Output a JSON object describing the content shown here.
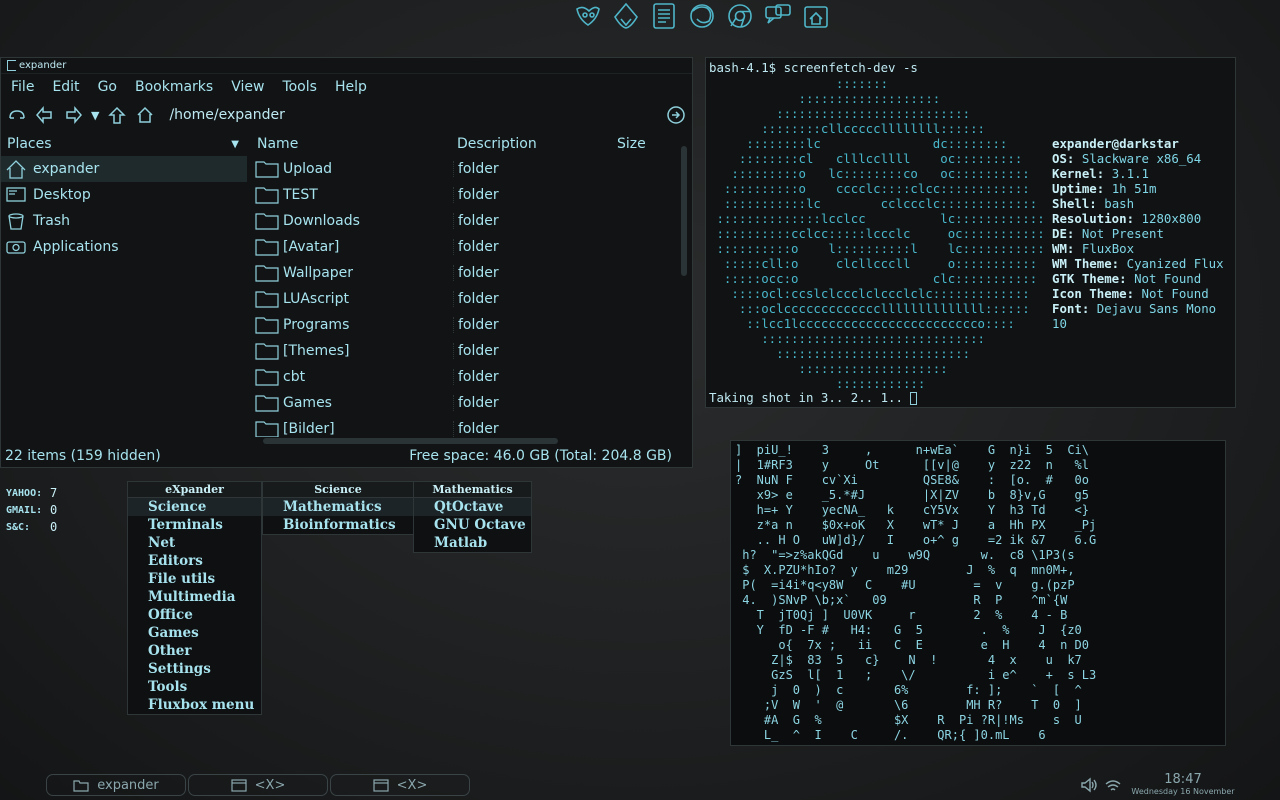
{
  "launcher": {
    "icons": [
      "gimp-icon",
      "inkscape-icon",
      "text-editor-icon",
      "firefox-icon",
      "chrome-icon",
      "chat-icon",
      "home-icon"
    ]
  },
  "filemanager": {
    "title": "expander",
    "menu": [
      "File",
      "Edit",
      "Go",
      "Bookmarks",
      "View",
      "Tools",
      "Help"
    ],
    "path": "/home/expander",
    "places_label": "Places",
    "places": [
      {
        "label": "expander",
        "icon": "home-icon",
        "selected": true
      },
      {
        "label": "Desktop",
        "icon": "desktop-icon",
        "selected": false
      },
      {
        "label": "Trash",
        "icon": "trash-icon",
        "selected": false
      },
      {
        "label": "Applications",
        "icon": "applications-icon",
        "selected": false
      }
    ],
    "columns": {
      "name": "Name",
      "desc": "Description",
      "size": "Size"
    },
    "files": [
      {
        "name": "Upload",
        "desc": "folder"
      },
      {
        "name": "TEST",
        "desc": "folder"
      },
      {
        "name": "Downloads",
        "desc": "folder"
      },
      {
        "name": "[Avatar]",
        "desc": "folder"
      },
      {
        "name": "Wallpaper",
        "desc": "folder"
      },
      {
        "name": "LUAscript",
        "desc": "folder"
      },
      {
        "name": "Programs",
        "desc": "folder"
      },
      {
        "name": "[Themes]",
        "desc": "folder"
      },
      {
        "name": "cbt",
        "desc": "folder"
      },
      {
        "name": "Games",
        "desc": "folder"
      },
      {
        "name": "[Bilder]",
        "desc": "folder"
      }
    ],
    "status_left": "22 items (159 hidden)",
    "status_right": "Free space: 46.0 GB (Total: 204.8 GB)"
  },
  "terminal": {
    "command": "bash-4.1$ screenfetch-dev -s",
    "ascii_art": "                 :::::::\n            :::::::::::::::::::\n         ::::::::::::::::::::::::::\n       ::::::::cllcccccllllllll::::::\n     ::::::::lc               dc::::::::\n    ::::::::cl   clllccllll    oc:::::::::\n   :::::::::o   lc::::::::co   oc::::::::::\n  ::::::::::o    cccclc::::clcc::::::::::::\n  :::::::::::lc        cclccclc:::::::::::::\n ::::::::::::::lcclcc          lc::::::::::::\n ::::::::::cclcc:::::lccclc     oc:::::::::::\n ::::::::::o    l::::::::::l    lc:::::::::::\n  :::::cll:o     clcllcccll     o:::::::::::\n  :::::occ:o                  clc:::::::::::\n   ::::ocl:ccslclccclclccclclc:::::::::::::\n    :::oclcccccccccccccllllllllllllll::::::\n     ::lcc1lcccccccccccccccccccccccco::::\n       ::::::::::::::::::::::::::::::\n         ::::::::::::::::::::::::::\n            ::::::::::::::::::::\n                 ::::::::::::",
    "user": "expander@darkstar",
    "info": [
      {
        "k": "OS:",
        "v": "Slackware x86_64"
      },
      {
        "k": "Kernel:",
        "v": "3.1.1"
      },
      {
        "k": "Uptime:",
        "v": "1h 51m"
      },
      {
        "k": "Shell:",
        "v": "bash"
      },
      {
        "k": "Resolution:",
        "v": "1280x800"
      },
      {
        "k": "DE:",
        "v": "Not Present"
      },
      {
        "k": "WM:",
        "v": "FluxBox"
      },
      {
        "k": "WM Theme:",
        "v": "Cyanized Flux"
      },
      {
        "k": "GTK Theme:",
        "v": "Not Found"
      },
      {
        "k": "Icon Theme:",
        "v": "Not Found"
      },
      {
        "k": "Font:",
        "v": "Dejavu Sans Mono 10"
      }
    ],
    "prompt": "Taking shot in 3.. 2.. 1.. "
  },
  "mail_status": [
    {
      "label": "YAHOO:",
      "count": "7"
    },
    {
      "label": "GMAIL:",
      "count": "0"
    },
    {
      "label": "S&C:",
      "count": "0"
    }
  ],
  "menus": {
    "root": {
      "title": "eXpander",
      "items": [
        "Science",
        "Terminals",
        "Net",
        "Editors",
        "File utils",
        "Multimedia",
        "Office",
        "Games",
        "Other",
        "Settings",
        "Tools",
        "Fluxbox menu"
      ]
    },
    "science": {
      "title": "Science",
      "items": [
        "Mathematics",
        "Bioinformatics"
      ]
    },
    "math": {
      "title": "Mathematics",
      "items": [
        "QtOctave",
        "GNU Octave",
        "Matlab"
      ]
    }
  },
  "matrix_text": "]  piU_!    3     ,      n+wEa`    G  n}i  5  Ci\\\n|  1#RF3    y     Ot      [[v|@    y  z22  n   %l\n?  NuN F    cv`Xi         QSE8&    :  [o.  #   0o\n   x9> e    _5.*#J        |X|ZV    b  8}v,G    g5\n   h=+ Y    yecNA_   k    cY5Vx    Y  h3 Td    <}\n   z*a n    $0x+oK   X    wT* J    a  Hh PX    _Pj\n   .. H O   uW]d}/   I    o+^ g    =2 ik &7    6.G\n h?  \"=>z%akQGd    u    w9Q       w.  c8 \\1P3(s\n $  X.PZU*hIo?  y    m29        J  %  q  mn0M+,\n P(  =i4i*q<y8W   C    #U        =  v    g.(pzP\n 4.  )SNvP \\b;x`   09            R  P    ^m`{W\n   T  jT0Qj ]  U0VK     r        2  %    4 - B\n   Y  fD -F #   H4:   G  5        .  %    J  {z0\n      o{  7x ;   ii   C  E        e  H    4  n D0\n     Z|$  83  5   c}    N  !       4  x    u  k7\n     GzS  l[  1   ;    \\/          i e^    +  s L3\n     j  0  )  c       6%        f: ];    `  [  ^\n    ;V  W  '  @       \\6        MH R?    T  0  ]\n    #A  G  %          $X    R  Pi ?R|!Ms    s  U\n    L_  ^  I    C     /.    QR;{ ]0.mL    6",
  "taskbar": [
    {
      "label": "expander",
      "icon": "folder-icon"
    },
    {
      "label": "<X>",
      "icon": "window-icon"
    },
    {
      "label": "<X>",
      "icon": "window-icon"
    }
  ],
  "clock": {
    "time": "18:47",
    "date": "Wednesday 16 November"
  }
}
